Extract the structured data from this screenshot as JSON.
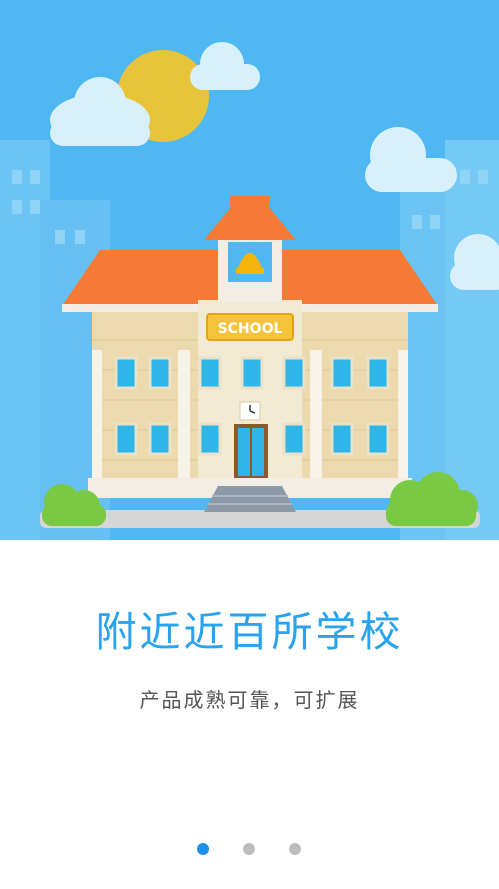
{
  "hero": {
    "sign_text": "SCHOOL",
    "colors": {
      "sky": "#4fb8f2",
      "roof": "#f47a35",
      "wall": "#ecd9ad",
      "sun": "#e8c43a",
      "bush": "#7ac943"
    }
  },
  "onboarding": {
    "title": "附近近百所学校",
    "subtitle": "产品成熟可靠，可扩展"
  },
  "pager": {
    "dots": [
      {
        "state": "active"
      },
      {
        "state": "inactive"
      },
      {
        "state": "inactive"
      }
    ]
  },
  "colors": {
    "accent": "#29a3ee",
    "dot_active": "#1e90e6",
    "dot_inactive": "#bdbdbd"
  }
}
